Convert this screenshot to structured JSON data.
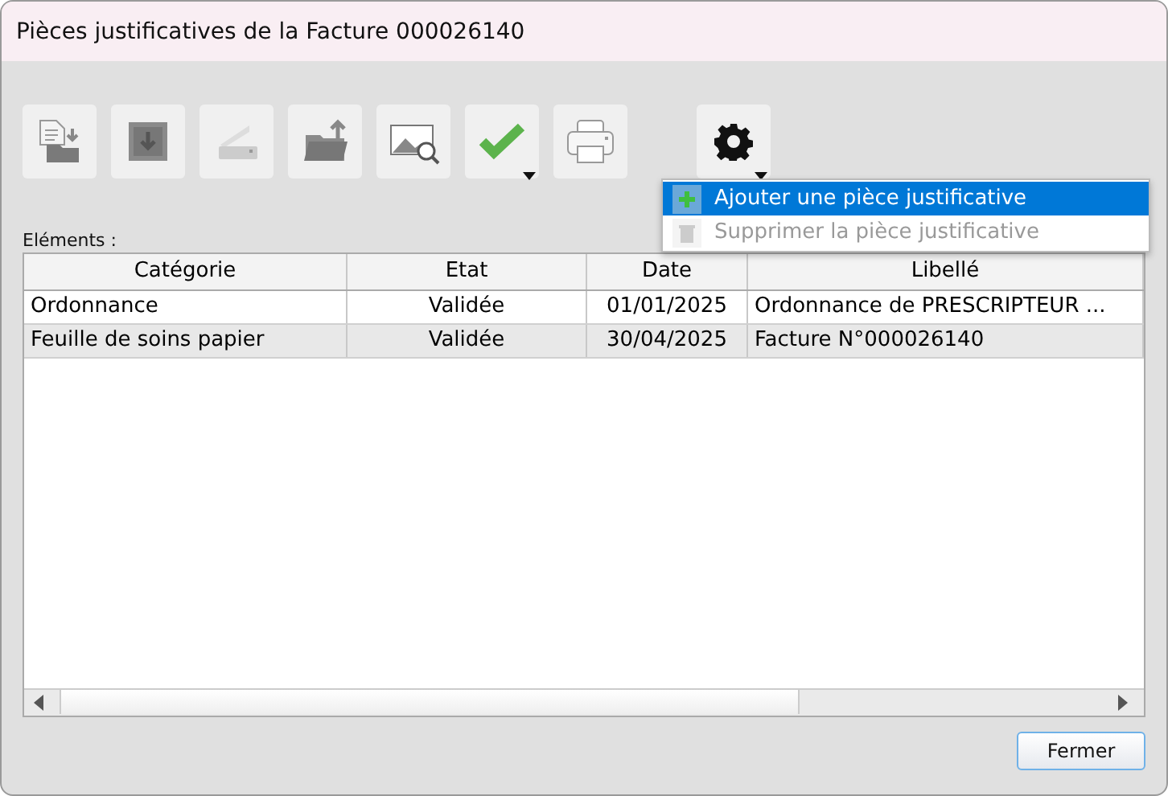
{
  "window": {
    "title": "Pièces justificatives de la Facture 000026140"
  },
  "toolbar": [
    {
      "kind": "import",
      "dropdown": false
    },
    {
      "kind": "download",
      "dropdown": false
    },
    {
      "kind": "scanner",
      "dropdown": false
    },
    {
      "kind": "upload",
      "dropdown": false
    },
    {
      "kind": "image",
      "dropdown": false
    },
    {
      "kind": "check",
      "dropdown": true
    },
    {
      "kind": "print",
      "dropdown": false
    },
    {
      "kind": "gear",
      "dropdown": true
    }
  ],
  "menu": [
    {
      "kind": "add",
      "label": "Ajouter une pièce justificative",
      "selected": true,
      "disabled": false
    },
    {
      "kind": "delete",
      "label": "Supprimer la pièce justificative",
      "selected": false,
      "disabled": true
    }
  ],
  "list_label": "Eléments :",
  "table": {
    "columns": [
      "Catégorie",
      "Etat",
      "Date",
      "Libellé"
    ],
    "rows": [
      [
        "Ordonnance",
        "Validée",
        "01/01/2025",
        "Ordonnance de PRESCRIPTEUR ..."
      ],
      [
        "Feuille de soins papier",
        "Validée",
        "30/04/2025",
        "Facture N°000026140"
      ]
    ]
  },
  "buttons": [
    "Fermer"
  ]
}
